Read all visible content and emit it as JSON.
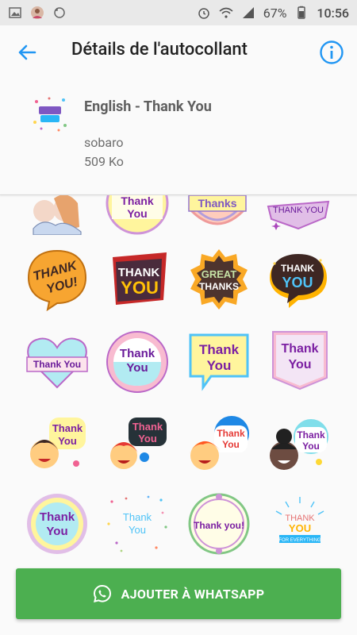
{
  "status_bar": {
    "battery": "67%",
    "time": "10:56"
  },
  "app_bar": {
    "title": "Détails de l'autocollant"
  },
  "pack": {
    "name": "English - Thank You",
    "author": "sobaro",
    "size": "509 Ko"
  },
  "stickers": [
    {
      "text": ""
    },
    {
      "text": "Thank You"
    },
    {
      "text": "Thanks"
    },
    {
      "text": "THANK YOU"
    },
    {
      "text": "THANK YOU!"
    },
    {
      "text": "THANK YOU"
    },
    {
      "text": "GREAT THANKS"
    },
    {
      "text": "THANK YOU"
    },
    {
      "text": "Thank You"
    },
    {
      "text": "Thank You"
    },
    {
      "text": "Thank You"
    },
    {
      "text": "Thank You"
    },
    {
      "text": "Thank You"
    },
    {
      "text": "Thank You"
    },
    {
      "text": "Thank You"
    },
    {
      "text": "Thank You"
    },
    {
      "text": "Thank You"
    },
    {
      "text": "Thank You"
    },
    {
      "text": "Thank you!"
    },
    {
      "text": "THANK YOU FOR EVERYTHING"
    }
  ],
  "button": {
    "label": "AJOUTER À WHATSAPP"
  },
  "colors": {
    "accent": "#2196f3",
    "button": "#4caf50"
  }
}
